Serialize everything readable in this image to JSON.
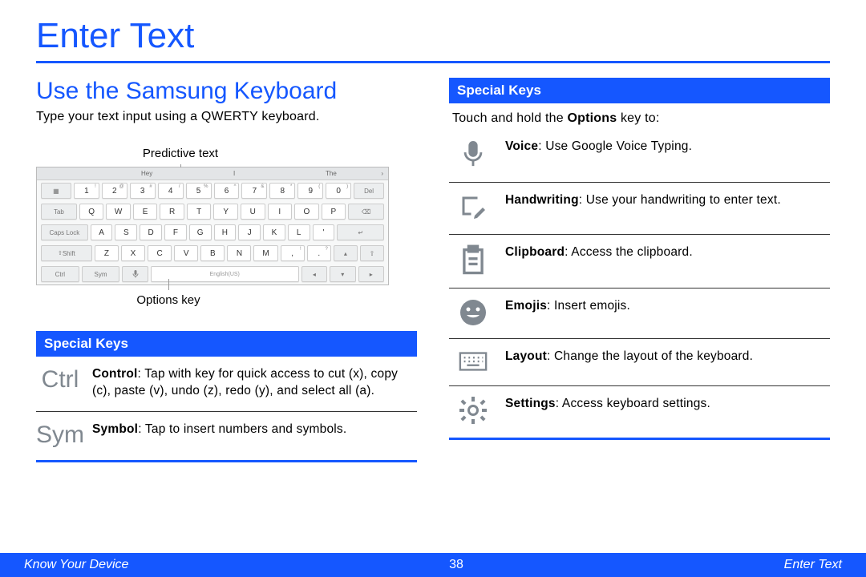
{
  "page_title": "Enter Text",
  "section_title": "Use the Samsung Keyboard",
  "intro_text": "Type your text input using a QWERTY keyboard.",
  "callout_predictive": "Predictive text",
  "callout_options": "Options key",
  "suggestions": {
    "s1": "Hey",
    "s2": "I",
    "s3": "The"
  },
  "kb": {
    "row0": {
      "del": "Del"
    },
    "row1": {
      "tab": "Tab",
      "q": "Q",
      "w": "W",
      "e": "E",
      "r": "R",
      "t": "T",
      "y": "Y",
      "u": "U",
      "i": "I",
      "o": "O",
      "p": "P"
    },
    "row2": {
      "caps": "Caps Lock",
      "a": "A",
      "s": "S",
      "d": "D",
      "f": "F",
      "g": "G",
      "h": "H",
      "j": "J",
      "k": "K",
      "l": "L"
    },
    "row3": {
      "shift": "Shift",
      "z": "Z",
      "x": "X",
      "c": "C",
      "v": "V",
      "b": "B",
      "n": "N",
      "m": "M"
    },
    "row4": {
      "ctrl": "Ctrl",
      "sym": "Sym",
      "lang": "English(US)"
    },
    "nums": {
      "n1": "1",
      "n2": "2",
      "n3": "3",
      "n4": "4",
      "n5": "5",
      "n6": "6",
      "n7": "7",
      "n8": "8",
      "n9": "9",
      "n0": "0"
    },
    "sups": {
      "s1": "!",
      "s2": "@",
      "s3": "#",
      "s4": "/",
      "s5": "%",
      "s6": "^",
      "s7": "&",
      "s8": "*",
      "s9": "(",
      "s0": ")"
    },
    "punct": {
      "comma": ",",
      "comma_sup": "!",
      "period": ".",
      "period_sup": "?",
      "apostrophe": "'"
    }
  },
  "left_bar_title": "Special Keys",
  "left_entries": {
    "ctrl_label": "Ctrl",
    "ctrl_title": "Control",
    "ctrl_body": ": Tap with key for quick access to cut (x), copy (c), paste (v), undo (z), redo (y), and select all (a).",
    "sym_label": "Sym",
    "sym_title": "Symbol",
    "sym_body": ": Tap to insert numbers and symbols."
  },
  "right_bar_title": "Special Keys",
  "options_intro_pre": "Touch and hold the ",
  "options_intro_bold": "Options",
  "options_intro_post": " key to:",
  "right_entries": {
    "voice_title": "Voice",
    "voice_body": ": Use Google Voice Typing.",
    "hand_title": "Handwriting",
    "hand_body": ": Use your handwriting to enter text.",
    "clip_title": "Clipboard",
    "clip_body": ": Access the clipboard.",
    "emoji_title": "Emojis",
    "emoji_body": ": Insert emojis.",
    "layout_title": "Layout",
    "layout_body": ": Change the layout of the keyboard.",
    "settings_title": "Settings",
    "settings_body": ": Access keyboard settings."
  },
  "footer": {
    "left": "Know Your Device",
    "center": "38",
    "right": "Enter Text"
  }
}
